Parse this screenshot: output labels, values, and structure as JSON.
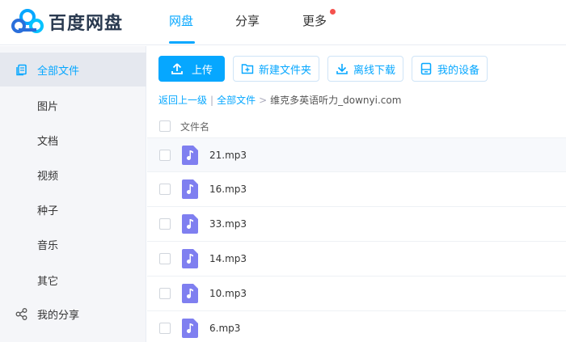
{
  "brand": {
    "name": "百度网盘"
  },
  "nav": {
    "items": [
      {
        "label": "网盘",
        "active": true
      },
      {
        "label": "分享",
        "active": false
      },
      {
        "label": "更多",
        "active": false,
        "badge": true
      }
    ]
  },
  "sidebar": {
    "items": [
      {
        "label": "全部文件",
        "icon": "files-icon",
        "active": true
      },
      {
        "label": "图片"
      },
      {
        "label": "文档"
      },
      {
        "label": "视频"
      },
      {
        "label": "种子"
      },
      {
        "label": "音乐"
      },
      {
        "label": "其它"
      },
      {
        "label": "我的分享",
        "icon": "share-icon"
      }
    ]
  },
  "toolbar": {
    "upload_label": "上传",
    "new_folder_label": "新建文件夹",
    "offline_download_label": "离线下载",
    "my_devices_label": "我的设备"
  },
  "breadcrumb": {
    "back_label": "返回上一级",
    "root_label": "全部文件",
    "current": "维克多英语听力_downyi.com"
  },
  "file_list": {
    "header_name": "文件名",
    "files": [
      {
        "name": "21.mp3"
      },
      {
        "name": "16.mp3"
      },
      {
        "name": "33.mp3"
      },
      {
        "name": "14.mp3"
      },
      {
        "name": "10.mp3"
      },
      {
        "name": "6.mp3"
      }
    ]
  },
  "colors": {
    "accent": "#06a7ff",
    "file_icon": "#7f7ff0",
    "badge": "#f5514d"
  }
}
